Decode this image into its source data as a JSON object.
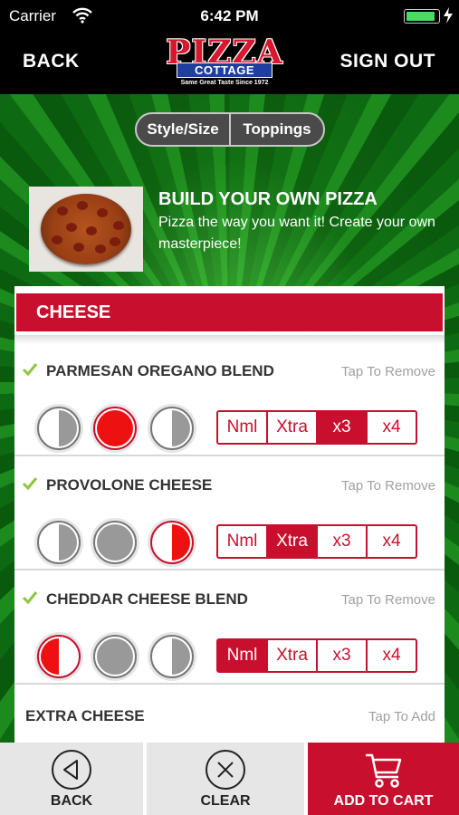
{
  "status_bar": {
    "carrier": "Carrier",
    "time": "6:42 PM",
    "battery_level": 0.9,
    "wifi_icon": "wifi-icon",
    "battery_icon": "battery-icon"
  },
  "nav": {
    "back_label": "BACK",
    "signout_label": "SIGN OUT",
    "logo": {
      "main": "PIZZA",
      "sub": "COTTAGE",
      "tagline": "Same Great Taste Since 1972"
    }
  },
  "tabs": [
    {
      "label": "Style/Size"
    },
    {
      "label": "Toppings"
    }
  ],
  "product": {
    "title": "BUILD YOUR OWN PIZZA",
    "description": "Pizza the way you want it! Create your own masterpiece!"
  },
  "section": {
    "title": "CHEESE"
  },
  "toppings": [
    {
      "name": "PARMESAN OREGANO BLEND",
      "action": "Tap To Remove",
      "checked": true,
      "selected_portion": "whole",
      "selected_qty": "x3"
    },
    {
      "name": "PROVOLONE CHEESE",
      "action": "Tap To Remove",
      "checked": true,
      "selected_portion": "right",
      "selected_qty": "Xtra"
    },
    {
      "name": "CHEDDAR CHEESE BLEND",
      "action": "Tap To Remove",
      "checked": true,
      "selected_portion": "left",
      "selected_qty": "Nml"
    }
  ],
  "quantity_options": [
    "Nml",
    "Xtra",
    "x3",
    "x4"
  ],
  "extra": {
    "name": "EXTRA CHEESE",
    "action": "Tap To Add"
  },
  "bottom_bar": {
    "back_label": "BACK",
    "clear_label": "CLEAR",
    "cart_label": "ADD TO CART"
  },
  "colors": {
    "accent": "#c8102e",
    "background": "#0c5c10"
  }
}
